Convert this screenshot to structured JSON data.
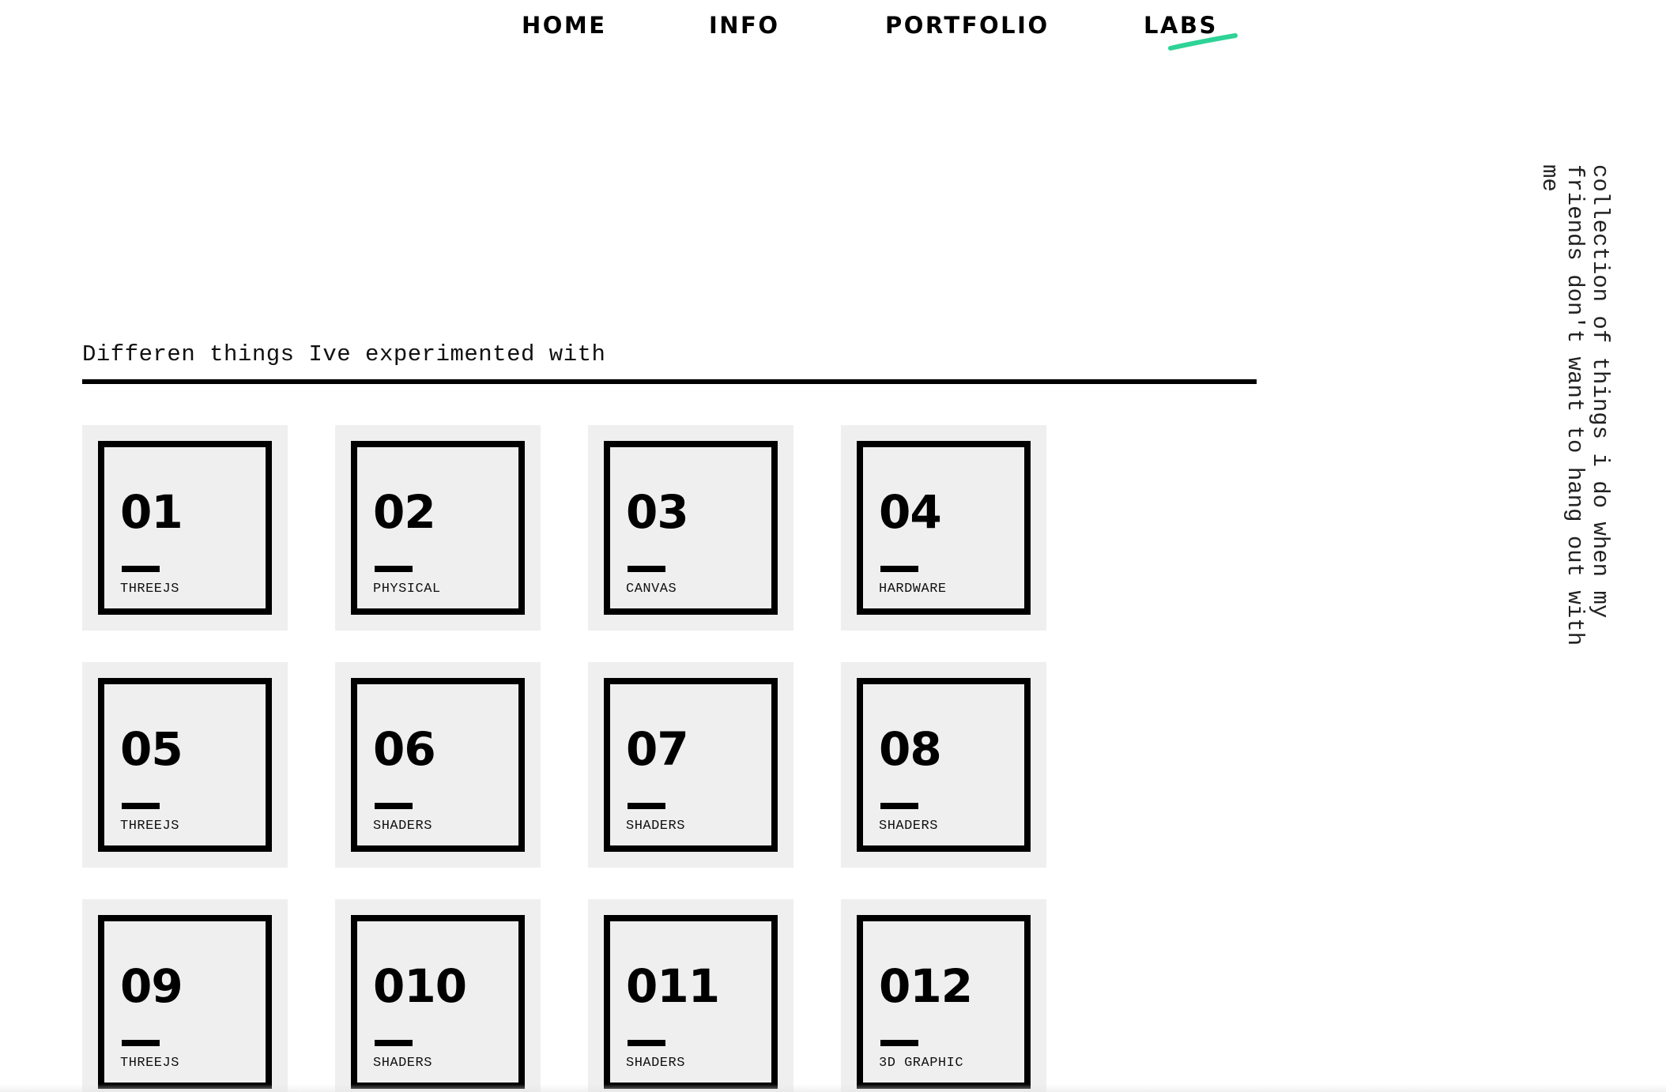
{
  "nav": {
    "items": [
      {
        "label": "HOME"
      },
      {
        "label": "INFO"
      },
      {
        "label": "PORTFOLIO"
      },
      {
        "label": "LABS",
        "active": true
      }
    ],
    "accent_color": "#2ed396"
  },
  "side_text": "collection of things i do when my friends don't want to hang out with me",
  "section": {
    "title": "Differen things Ive experimented with"
  },
  "cards": [
    {
      "number": "01",
      "tag": "THREEJS"
    },
    {
      "number": "02",
      "tag": "PHYSICAL"
    },
    {
      "number": "03",
      "tag": "CANVAS"
    },
    {
      "number": "04",
      "tag": "HARDWARE"
    },
    {
      "number": "05",
      "tag": "THREEJS"
    },
    {
      "number": "06",
      "tag": "SHADERS"
    },
    {
      "number": "07",
      "tag": "SHADERS"
    },
    {
      "number": "08",
      "tag": "SHADERS"
    },
    {
      "number": "09",
      "tag": "THREEJS"
    },
    {
      "number": "010",
      "tag": "SHADERS"
    },
    {
      "number": "011",
      "tag": "SHADERS"
    },
    {
      "number": "012",
      "tag": "3D GRAPHIC"
    }
  ]
}
